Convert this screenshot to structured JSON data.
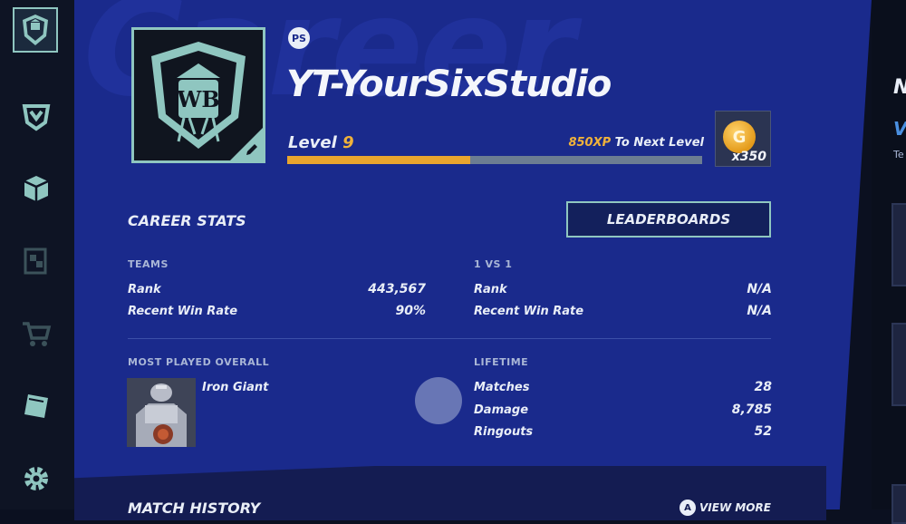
{
  "sidebar": {
    "items": [
      {
        "icon": "wb-shield-icon"
      },
      {
        "icon": "emblem-icon"
      },
      {
        "icon": "box-icon"
      },
      {
        "icon": "collection-icon"
      },
      {
        "icon": "cart-icon"
      },
      {
        "icon": "book-icon"
      },
      {
        "icon": "gear-icon"
      }
    ]
  },
  "header": {
    "background_word": "Career",
    "platform": "PS",
    "username": "YT-YourSixStudio",
    "level_label": "Level",
    "level_value": "9",
    "xp_amount": "850XP",
    "xp_suffix": " To Next Level",
    "xp_progress": 0.44,
    "currency_symbol": "G",
    "currency_count": "x350"
  },
  "career_stats": {
    "title": "CAREER STATS",
    "leaderboards_label": "LEADERBOARDS",
    "teams": {
      "heading": "TEAMS",
      "rows": [
        {
          "label": "Rank",
          "value": "443,567"
        },
        {
          "label": "Recent Win Rate",
          "value": "90%"
        }
      ]
    },
    "one_vs_one": {
      "heading": "1 VS 1",
      "rows": [
        {
          "label": "Rank",
          "value": "N/A"
        },
        {
          "label": "Recent Win Rate",
          "value": "N/A"
        }
      ]
    },
    "most_played": {
      "heading": "MOST PLAYED OVERALL",
      "character": "Iron Giant"
    },
    "lifetime": {
      "heading": "LIFETIME",
      "rows": [
        {
          "label": "Matches",
          "value": "28"
        },
        {
          "label": "Damage",
          "value": "8,785"
        },
        {
          "label": "Ringouts",
          "value": "52"
        }
      ]
    }
  },
  "match_history": {
    "title": "MATCH HISTORY",
    "button_glyph": "A",
    "view_more_label": "VIEW MORE"
  },
  "right_panel": {
    "letter": "N",
    "letter2": "V",
    "small_text": "Te"
  },
  "colors": {
    "accent_teal": "#8fc6c0",
    "xp_gold": "#e9a52e",
    "panel_blue": "#1a2a8c"
  }
}
